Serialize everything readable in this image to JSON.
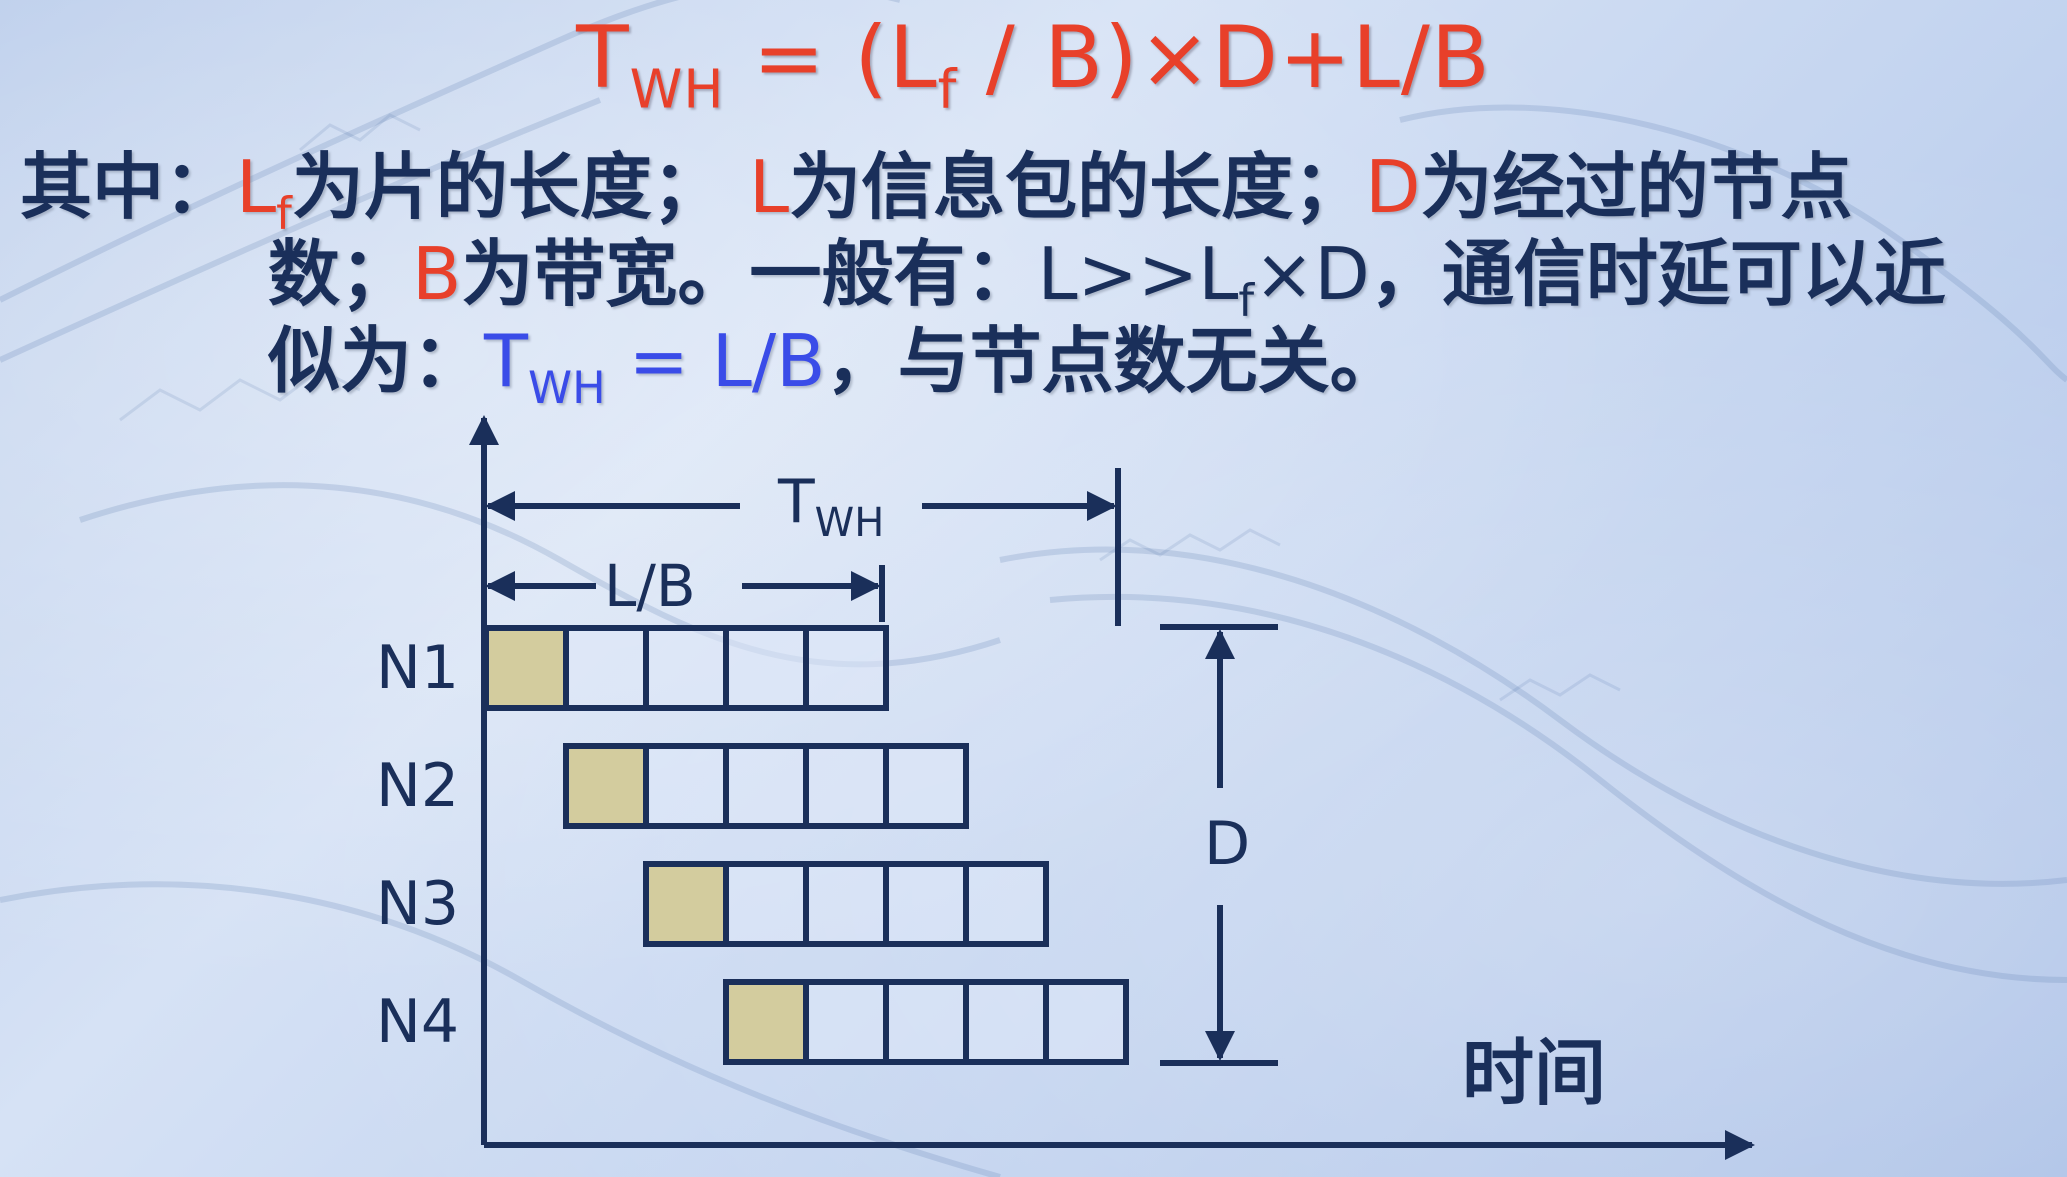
{
  "formula": {
    "t": "T",
    "t_sub": "WH",
    "rhs_1": " = (L",
    "rhs_sub": "f",
    "rhs_2": " / B)×D+L/B"
  },
  "explanation": {
    "line1": {
      "lead": "其中：",
      "lf": "L",
      "lf_sub": "f",
      "part1": "为片的长度；",
      "l": "L",
      "part2": "为信息包的长度；",
      "d": "D",
      "part3": "为经过的节点"
    },
    "line2": {
      "part1": "数；",
      "b": "B",
      "part2": "为带宽。一般有：",
      "cond_1": "L>>L",
      "cond_sub": "f",
      "cond_2": "×D",
      "part3": "，通信时延可以近"
    },
    "line3": {
      "part1": "似为：",
      "approx_t": "T",
      "approx_sub": "WH",
      "approx_rest": " = L/B",
      "part2": "，与节点数无关。"
    }
  },
  "diagram": {
    "twh_label": "T",
    "twh_sub": "WH",
    "lb_label": "L/B",
    "d_label": "D",
    "time_axis_label": "时间",
    "nodes": [
      "N1",
      "N2",
      "N3",
      "N4"
    ],
    "flits_per_packet": 5,
    "colors": {
      "line": "#1a2f5a",
      "head_flit": "#d3cc9e",
      "body_flit": "#dfe8f7",
      "formula_red": "#e8402a",
      "approx_blue": "#3a4ce8"
    }
  }
}
